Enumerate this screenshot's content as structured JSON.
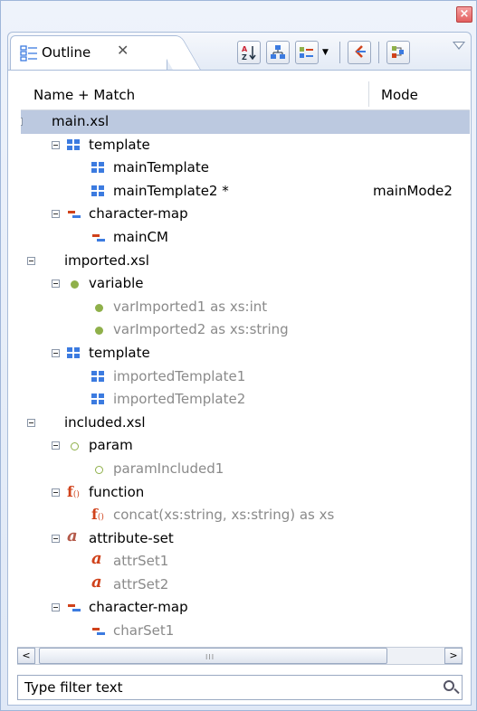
{
  "view": {
    "tab_label": "Outline",
    "tab_close_glyph": "✕",
    "close_glyph": "×",
    "toolbar_icons": [
      "sort-alpha-icon",
      "hierarchy-icon",
      "component-filter-icon",
      "link-with-editor-icon",
      "show-types-icon"
    ],
    "view_menu_icon": "chevron-down-icon"
  },
  "columns": {
    "name": "Name + Match",
    "mode": "Mode"
  },
  "tree": [
    {
      "level": 0,
      "toggle": true,
      "icon": "none",
      "label": "main.xsl",
      "dim": false,
      "mode": "",
      "selected": true
    },
    {
      "level": 1,
      "toggle": true,
      "icon": "template",
      "label": "template",
      "dim": false,
      "mode": ""
    },
    {
      "level": 2,
      "toggle": false,
      "icon": "template",
      "label": "mainTemplate",
      "dim": false,
      "mode": ""
    },
    {
      "level": 2,
      "toggle": false,
      "icon": "template",
      "label": "mainTemplate2 *",
      "dim": false,
      "mode": "mainMode2"
    },
    {
      "level": 1,
      "toggle": true,
      "icon": "charmap",
      "label": "character-map",
      "dim": false,
      "mode": ""
    },
    {
      "level": 2,
      "toggle": false,
      "icon": "charmap",
      "label": "mainCM",
      "dim": false,
      "mode": ""
    },
    {
      "level": 0,
      "toggle": true,
      "icon": "none",
      "label": "imported.xsl",
      "dim": false,
      "mode": ""
    },
    {
      "level": 1,
      "toggle": true,
      "icon": "variable",
      "label": "variable",
      "dim": false,
      "mode": ""
    },
    {
      "level": 2,
      "toggle": false,
      "icon": "variable",
      "label": "varImported1 as xs:int",
      "dim": true,
      "mode": ""
    },
    {
      "level": 2,
      "toggle": false,
      "icon": "variable",
      "label": "varImported2 as xs:string",
      "dim": true,
      "mode": ""
    },
    {
      "level": 1,
      "toggle": true,
      "icon": "template",
      "label": "template",
      "dim": false,
      "mode": ""
    },
    {
      "level": 2,
      "toggle": false,
      "icon": "template",
      "label": "importedTemplate1",
      "dim": true,
      "mode": ""
    },
    {
      "level": 2,
      "toggle": false,
      "icon": "template",
      "label": "importedTemplate2",
      "dim": true,
      "mode": ""
    },
    {
      "level": 0,
      "toggle": true,
      "icon": "none",
      "label": "included.xsl",
      "dim": false,
      "mode": ""
    },
    {
      "level": 1,
      "toggle": true,
      "icon": "param",
      "label": "param",
      "dim": false,
      "mode": ""
    },
    {
      "level": 2,
      "toggle": false,
      "icon": "param",
      "label": "paramIncluded1",
      "dim": true,
      "mode": ""
    },
    {
      "level": 1,
      "toggle": true,
      "icon": "function",
      "label": "function",
      "dim": false,
      "mode": ""
    },
    {
      "level": 2,
      "toggle": false,
      "icon": "function",
      "label": "concat(xs:string, xs:string) as xs",
      "dim": true,
      "mode": ""
    },
    {
      "level": 1,
      "toggle": true,
      "icon": "attrset",
      "label": "attribute-set",
      "dim": false,
      "mode": ""
    },
    {
      "level": 2,
      "toggle": false,
      "icon": "attrset",
      "label": "attrSet1",
      "dim": true,
      "mode": ""
    },
    {
      "level": 2,
      "toggle": false,
      "icon": "attrset",
      "label": "attrSet2",
      "dim": true,
      "mode": ""
    },
    {
      "level": 1,
      "toggle": true,
      "icon": "charmap",
      "label": "character-map",
      "dim": false,
      "mode": ""
    },
    {
      "level": 2,
      "toggle": false,
      "icon": "charmap",
      "label": "charSet1",
      "dim": true,
      "mode": ""
    }
  ],
  "scrollbar": {
    "left_glyph": "<",
    "right_glyph": ">",
    "grip_glyph": "III"
  },
  "filter": {
    "placeholder": "Type filter text",
    "value": ""
  },
  "colors": {
    "selection": "#bcc9e0",
    "template_icon": "#3c7be0",
    "variable_icon": "#8fb04a",
    "param_icon": "#8fb04a",
    "function_icon": "#d0421b",
    "attrset_icon_active": "#b45a4a",
    "attrset_icon": "#d0421b",
    "charmap_icon_red": "#d0421b",
    "charmap_icon_blue": "#3c7be0",
    "dim_text": "#8a8a8a"
  }
}
